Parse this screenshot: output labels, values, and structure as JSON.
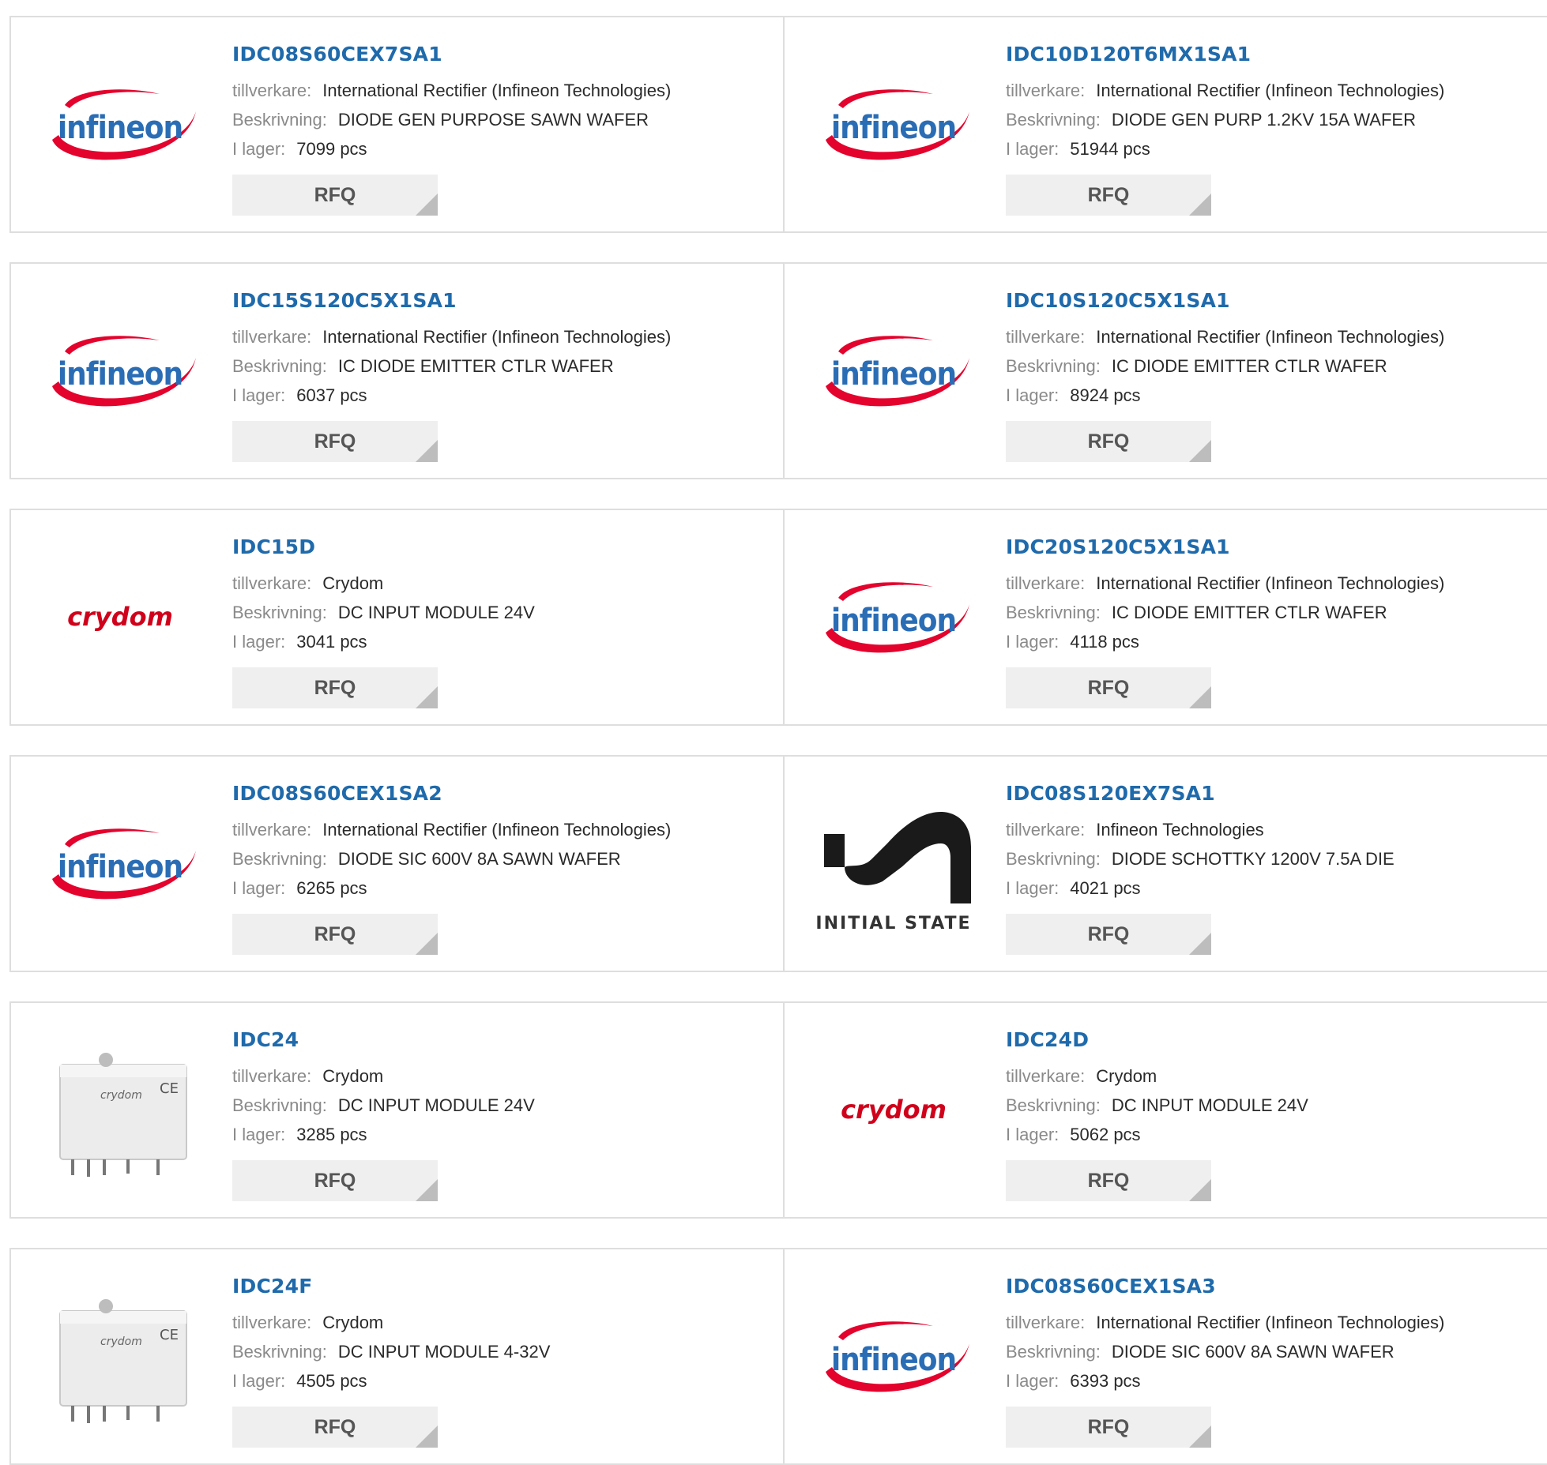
{
  "labels": {
    "maker": "tillverkare:",
    "desc": "Beskrivning:",
    "stock": "I lager:"
  },
  "colors": {
    "part_link": "#1f6aab",
    "infineon_red": "#e3032d",
    "infineon_blue": "#2a6db5",
    "rfq_bg": "#efefef"
  },
  "rows": [
    {
      "left": {
        "part": "IDC08S60CEX7SA1",
        "maker": "International Rectifier (Infineon Technologies)",
        "desc": "DIODE GEN PURPOSE SAWN WAFER",
        "stock": "7099 pcs",
        "rfq": "RFQ",
        "logo": "infineon",
        "logo_text": "infineon"
      },
      "right": {
        "part": "IDC10D120T6MX1SA1",
        "maker": "International Rectifier (Infineon Technologies)",
        "desc": "DIODE GEN PURP 1.2KV 15A WAFER",
        "stock": "51944 pcs",
        "rfq": "RFQ",
        "logo": "infineon",
        "logo_text": "infineon"
      }
    },
    {
      "left": {
        "part": "IDC15S120C5X1SA1",
        "maker": "International Rectifier (Infineon Technologies)",
        "desc": "IC DIODE EMITTER CTLR WAFER",
        "stock": "6037 pcs",
        "rfq": "RFQ",
        "logo": "infineon",
        "logo_text": "infineon"
      },
      "right": {
        "part": "IDC10S120C5X1SA1",
        "maker": "International Rectifier (Infineon Technologies)",
        "desc": "IC DIODE EMITTER CTLR WAFER",
        "stock": "8924 pcs",
        "rfq": "RFQ",
        "logo": "infineon",
        "logo_text": "infineon"
      }
    },
    {
      "left": {
        "part": "IDC15D",
        "maker": "Crydom",
        "desc": "DC INPUT MODULE 24V",
        "stock": "3041 pcs",
        "rfq": "RFQ",
        "logo": "crydom",
        "logo_text": "crydom"
      },
      "right": {
        "part": "IDC20S120C5X1SA1",
        "maker": "International Rectifier (Infineon Technologies)",
        "desc": "IC DIODE EMITTER CTLR WAFER",
        "stock": "4118 pcs",
        "rfq": "RFQ",
        "logo": "infineon",
        "logo_text": "infineon"
      }
    },
    {
      "left": {
        "part": "IDC08S60CEX1SA2",
        "maker": "International Rectifier (Infineon Technologies)",
        "desc": "DIODE SIC 600V 8A SAWN WAFER",
        "stock": "6265 pcs",
        "rfq": "RFQ",
        "logo": "infineon",
        "logo_text": "infineon"
      },
      "right": {
        "part": "IDC08S120EX7SA1",
        "maker": "Infineon Technologies",
        "desc": "DIODE SCHOTTKY 1200V 7.5A DIE",
        "stock": "4021 pcs",
        "rfq": "RFQ",
        "logo": "initialstate",
        "logo_text": "INITIAL STATE"
      }
    },
    {
      "left": {
        "part": "IDC24",
        "maker": "Crydom",
        "desc": "DC INPUT MODULE 24V",
        "stock": "3285 pcs",
        "rfq": "RFQ",
        "logo": "module",
        "logo_text": "crydom"
      },
      "right": {
        "part": "IDC24D",
        "maker": "Crydom",
        "desc": "DC INPUT MODULE 24V",
        "stock": "5062 pcs",
        "rfq": "RFQ",
        "logo": "crydom",
        "logo_text": "crydom"
      }
    },
    {
      "left": {
        "part": "IDC24F",
        "maker": "Crydom",
        "desc": "DC INPUT MODULE 4-32V",
        "stock": "4505 pcs",
        "rfq": "RFQ",
        "logo": "module",
        "logo_text": "crydom"
      },
      "right": {
        "part": "IDC08S60CEX1SA3",
        "maker": "International Rectifier (Infineon Technologies)",
        "desc": "DIODE SIC 600V 8A SAWN WAFER",
        "stock": "6393 pcs",
        "rfq": "RFQ",
        "logo": "infineon",
        "logo_text": "infineon"
      }
    }
  ]
}
